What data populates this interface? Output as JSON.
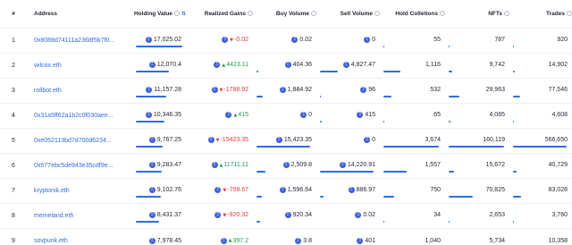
{
  "header": {
    "rank": "#",
    "address": "Address",
    "holding_value": "Holding Value",
    "realized_gains": "Realized Gains",
    "buy_volume": "Buy Volume",
    "sell_volume": "Sell Volume",
    "hold_collections": "Hold Colletions",
    "nfts": "NFTs",
    "trades": "Trades",
    "sort_icon": "sort-desc-icon",
    "info_icon": "info-icon"
  },
  "colors": {
    "link": "#2f6fd6",
    "negative": "#e0383e",
    "positive": "#1f9d55",
    "eth": "#3f5fd8"
  },
  "rows": [
    {
      "rank": "1",
      "address": "0x8088d74111a2368f5b7f0...",
      "holding": "17,025.02",
      "holding_pct": 1.0,
      "gain": "-0.02",
      "gain_dir": "down",
      "buy": "0.02",
      "buy_pct": 0.0,
      "sell": "0",
      "sell_pct": 0.0,
      "collections": "55",
      "coll_pct": 0.01,
      "nfts": "787",
      "nft_pct": 0.005,
      "trades": "920",
      "trade_pct": 0.002
    },
    {
      "rank": "2",
      "address": "wilcox.eth",
      "holding": "12,070.4",
      "holding_pct": 0.71,
      "gain": "4423.11",
      "gain_dir": "up",
      "buy": "404.36",
      "buy_pct": 0.03,
      "sell": "4,827.47",
      "sell_pct": 0.34,
      "collections": "1,116",
      "coll_pct": 0.3,
      "nfts": "9,742",
      "nft_pct": 0.06,
      "trades": "14,902",
      "trade_pct": 0.03
    },
    {
      "rank": "3",
      "address": "rollbot.eth",
      "holding": "11,157.28",
      "holding_pct": 0.66,
      "gain": "-1788.92",
      "gain_dir": "down",
      "buy": "1,884.92",
      "buy_pct": 0.12,
      "sell": "96",
      "sell_pct": 0.01,
      "collections": "532",
      "coll_pct": 0.14,
      "nfts": "29,963",
      "nft_pct": 0.19,
      "trades": "77,546",
      "trade_pct": 0.14
    },
    {
      "rank": "4",
      "address": "0x31a5ff62a1b2c0f030aee...",
      "holding": "10,346.35",
      "holding_pct": 0.61,
      "gain": "415",
      "gain_dir": "up",
      "buy": "0",
      "buy_pct": 0.0,
      "sell": "415",
      "sell_pct": 0.03,
      "collections": "65",
      "coll_pct": 0.02,
      "nfts": "4,085",
      "nft_pct": 0.03,
      "trades": "4,608",
      "trade_pct": 0.01
    },
    {
      "rank": "5",
      "address": "0xe052113bd7d700d6234...",
      "holding": "9,767.25",
      "holding_pct": 0.57,
      "gain": "-15423.35",
      "gain_dir": "down",
      "buy": "15,423.35",
      "buy_pct": 1.0,
      "sell": "0",
      "sell_pct": 0.0,
      "collections": "3,674",
      "coll_pct": 1.0,
      "nfts": "160,119",
      "nft_pct": 1.0,
      "trades": "566,650",
      "trade_pct": 1.0
    },
    {
      "rank": "6",
      "address": "0x577ebc5de943e35cdf9e...",
      "holding": "9,283.47",
      "holding_pct": 0.55,
      "gain": "11711.11",
      "gain_dir": "up",
      "buy": "2,509.8",
      "buy_pct": 0.16,
      "sell": "14,220.91",
      "sell_pct": 1.0,
      "collections": "1,557",
      "coll_pct": 0.42,
      "nfts": "15,672",
      "nft_pct": 0.1,
      "trades": "40,729",
      "trade_pct": 0.07
    },
    {
      "rank": "7",
      "address": "kryptonik.eth",
      "holding": "9,102.76",
      "holding_pct": 0.53,
      "gain": "-709.67",
      "gain_dir": "down",
      "buy": "1,596.64",
      "buy_pct": 0.1,
      "sell": "886.97",
      "sell_pct": 0.06,
      "collections": "750",
      "coll_pct": 0.2,
      "nfts": "70,825",
      "nft_pct": 0.44,
      "trades": "83,028",
      "trade_pct": 0.15
    },
    {
      "rank": "8",
      "address": "memeland.eth",
      "holding": "8,431.37",
      "holding_pct": 0.5,
      "gain": "-920.32",
      "gain_dir": "down",
      "buy": "920.34",
      "buy_pct": 0.06,
      "sell": "0.02",
      "sell_pct": 0.0,
      "collections": "34",
      "coll_pct": 0.01,
      "nfts": "2,653",
      "nft_pct": 0.02,
      "trades": "3,760",
      "trade_pct": 0.01
    },
    {
      "rank": "9",
      "address": "sovpunk.eth",
      "holding": "7,978.45",
      "holding_pct": 0.47,
      "gain": "397.2",
      "gain_dir": "up",
      "buy": "3.8",
      "buy_pct": 0.0,
      "sell": "401",
      "sell_pct": 0.03,
      "collections": "1,040",
      "coll_pct": 0.28,
      "nfts": "5,734",
      "nft_pct": 0.04,
      "trades": "10,358",
      "trade_pct": 0.02
    }
  ]
}
